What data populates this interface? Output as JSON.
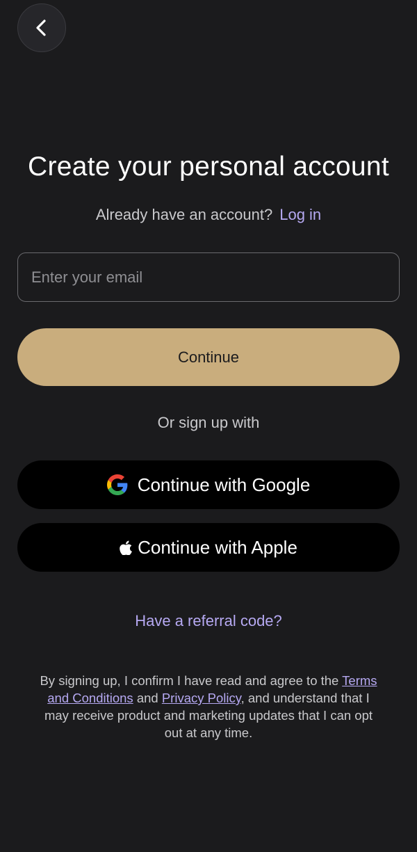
{
  "header": {
    "back_icon": "chevron-left-icon"
  },
  "main": {
    "title": "Create your personal account",
    "login_prompt": "Already have an account?",
    "login_link": "Log in",
    "email_placeholder": "Enter your email",
    "email_value": "",
    "continue_label": "Continue",
    "divider_text": "Or sign up with",
    "google_label": "Continue with Google",
    "google_icon": "google-icon",
    "apple_label": "Continue with Apple",
    "apple_icon": "apple-icon",
    "referral_link": "Have a referral code?"
  },
  "legal": {
    "prefix": "By signing up, I confirm I have read and agree to the",
    "terms_link": "Terms and Conditions",
    "and": "and",
    "privacy_link": "Privacy Policy",
    "suffix": ", and understand that I may receive product and marketing updates that I can opt out at any time."
  },
  "colors": {
    "background": "#1b1b1d",
    "accent_button": "#c9ad7d",
    "link": "#b6a9f2",
    "social_button": "#000000"
  }
}
